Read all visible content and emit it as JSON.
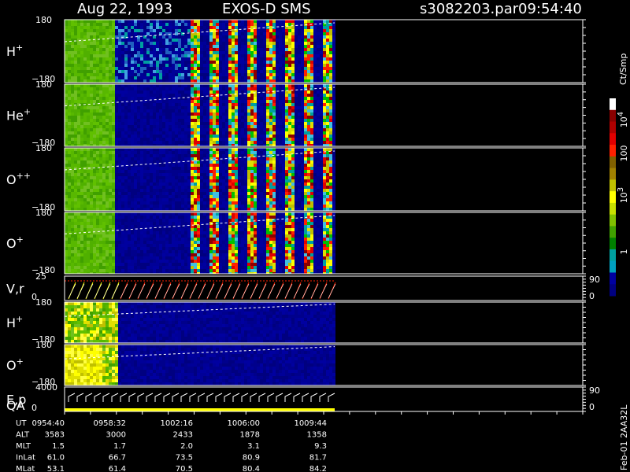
{
  "header": {
    "date": "Aug 22, 1993",
    "instrument": "EXOS-D SMS",
    "file": "s3082203.par",
    "time": "09:54:40"
  },
  "colorbar": {
    "unit": "Ct/Smp",
    "labels": [
      "10",
      "100",
      "10",
      "1"
    ],
    "superscripts": [
      "4",
      "",
      "3",
      ""
    ],
    "colors": [
      "#ffffff",
      "#8b0000",
      "#b00000",
      "#e00000",
      "#ff2000",
      "#806000",
      "#a08000",
      "#c0c000",
      "#ffff00",
      "#c8e000",
      "#80c000",
      "#40a000",
      "#008000",
      "#00a0a0",
      "#00a0c0",
      "#0000a0",
      "#000080"
    ]
  },
  "panels": [
    {
      "name": "H+",
      "label": "H",
      "sup": "+",
      "ytop": "180",
      "ybot": "−180"
    },
    {
      "name": "He+",
      "label": "He",
      "sup": "+",
      "ytop": "180",
      "ybot": "−180"
    },
    {
      "name": "O++",
      "label": "O",
      "sup": "++",
      "ytop": "180",
      "ybot": "−180"
    },
    {
      "name": "O+",
      "label": "O",
      "sup": "+",
      "ytop": "180",
      "ybot": "−180"
    },
    {
      "name": "V,r",
      "label": "V,r",
      "sup": "",
      "ytop": "25",
      "ybot": "0",
      "rtop": "90",
      "rbot": "0"
    },
    {
      "name": "H+ (2)",
      "label": "H",
      "sup": "+",
      "ytop": "180",
      "ybot": "−180"
    },
    {
      "name": "O+ (2)",
      "label": "O",
      "sup": "+",
      "ytop": "180",
      "ybot": "−180"
    },
    {
      "name": "E,p QA",
      "label": "E,p",
      "label2": "QA",
      "sup": "",
      "ytop": "4000",
      "ybot": "0",
      "rtop": "90",
      "rbot": "0"
    }
  ],
  "sidebar_code": "Feb-01 2AA32L",
  "chart_data": {
    "type": "heatmap",
    "title": "Aug 22, 1993   EXOS-D SMS   s3082203.par  09:54:40",
    "x_ticks": [
      "0954:40",
      "0958:32",
      "1002:16",
      "1006:00",
      "1009:44"
    ],
    "ephemeris": [
      {
        "label": "UT",
        "values": [
          "0954:40",
          "0958:32",
          "1002:16",
          "1006:00",
          "1009:44"
        ]
      },
      {
        "label": "ALT",
        "values": [
          "3583",
          "3000",
          "2433",
          "1878",
          "1358"
        ]
      },
      {
        "label": "MLT",
        "values": [
          "1.5",
          "1.7",
          "2.0",
          "3.1",
          "9.3"
        ]
      },
      {
        "label": "InLat",
        "values": [
          "61.0",
          "66.7",
          "73.5",
          "80.9",
          "81.7"
        ]
      },
      {
        "label": "MLat",
        "values": [
          "53.1",
          "61.4",
          "70.5",
          "80.4",
          "84.2"
        ]
      }
    ],
    "ylim": [
      -180,
      180
    ],
    "colorbar_range": [
      1,
      10000
    ],
    "colorbar_scale": "log"
  }
}
